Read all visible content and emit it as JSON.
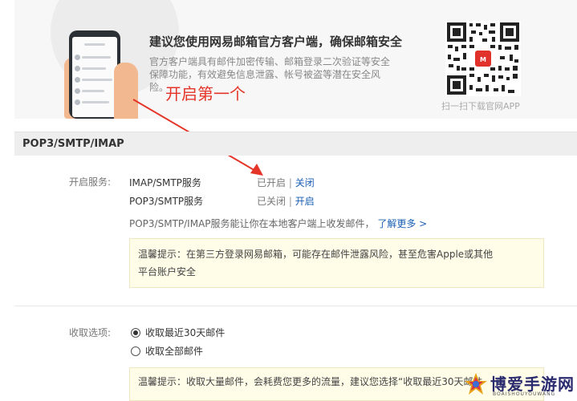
{
  "promo": {
    "title": "建议您使用网易邮箱官方客户端，确保邮箱安全",
    "desc_line1": "官方客户端具有邮件加密传输、邮箱登录二次验证等安全",
    "desc_line2": "保障功能，有效避免信息泄露、帐号被盗等潜在安全风险。",
    "qr_caption": "扫一扫下载官网APP"
  },
  "annotation": {
    "text": "开启第一个",
    "color": "#e53528"
  },
  "section": {
    "title": "POP3/SMTP/IMAP"
  },
  "services": {
    "label": "开启服务:",
    "items": [
      {
        "name": "IMAP/SMTP服务",
        "status": "已开启",
        "sep": "|",
        "action": "关闭"
      },
      {
        "name": "POP3/SMTP服务",
        "status": "已关闭",
        "sep": "|",
        "action": "开启"
      }
    ],
    "info": "POP3/SMTP/IMAP服务能让你在本地客户端上收发邮件，",
    "learn_more": "了解更多 >"
  },
  "tip1": {
    "line1": "温馨提示：在第三方登录网易邮箱，可能存在邮件泄露风险，甚至危害Apple或其他",
    "line2": "平台账户安全"
  },
  "receive": {
    "label": "收取选项:",
    "options": [
      {
        "label": "收取最近30天邮件",
        "checked": true
      },
      {
        "label": "收取全部邮件",
        "checked": false
      }
    ]
  },
  "tip2": {
    "text": "温馨提示：收取大量邮件，会耗费您更多的流量，建议您选择“收取最近30天邮件"
  },
  "watermark": {
    "name": "博爱手游网",
    "sub": "BOAISHOUYOUWANG"
  },
  "colors": {
    "link": "#1a5fb4",
    "tip_bg": "#fffde8",
    "header_bg": "#eeeeee"
  }
}
